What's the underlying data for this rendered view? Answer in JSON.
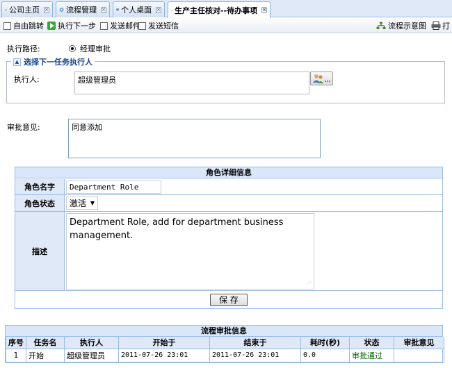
{
  "tabs": [
    {
      "label": "公司主页",
      "icon": "home-icon"
    },
    {
      "label": "流程管理",
      "icon": "gear-icon"
    },
    {
      "label": "个人桌面",
      "icon": "monitor-icon"
    },
    {
      "label": "生产主任核对--待办事项",
      "icon": "edit-icon",
      "active": true
    }
  ],
  "toolbar": {
    "free_jump": "自由跳转",
    "next_step": "执行下一步",
    "send_mail": "发送邮件",
    "send_sms": "发送短信",
    "flow_diagram": "流程示意图",
    "print": "打"
  },
  "form": {
    "path_label": "执行路径:",
    "path_value": "经理审批",
    "next_task_legend": "选择下一任务执行人",
    "executor_label": "执行人:",
    "executor_value": "超级管理员",
    "opinion_label": "审批意见:",
    "opinion_value": "同意添加"
  },
  "role": {
    "title": "角色详细信息",
    "name_label": "角色名字",
    "name_value": "Department Role",
    "status_label": "角色状态",
    "status_value": "激活",
    "desc_label": "描述",
    "desc_value": "Department Role, add for department business management.",
    "save_label": "保 存"
  },
  "approval": {
    "title": "流程审批信息",
    "headers": [
      "序号",
      "任务名",
      "执行人",
      "开始于",
      "结束于",
      "耗时(秒)",
      "状态",
      "审批意见"
    ],
    "rows": [
      [
        "1",
        "开始",
        "超级管理员",
        "2011-07-26 23:01",
        "2011-07-26 23:01",
        "0.0",
        "审批通过",
        ""
      ]
    ]
  },
  "colors": {
    "accent": "#15428b",
    "status_ok": "#006600"
  }
}
